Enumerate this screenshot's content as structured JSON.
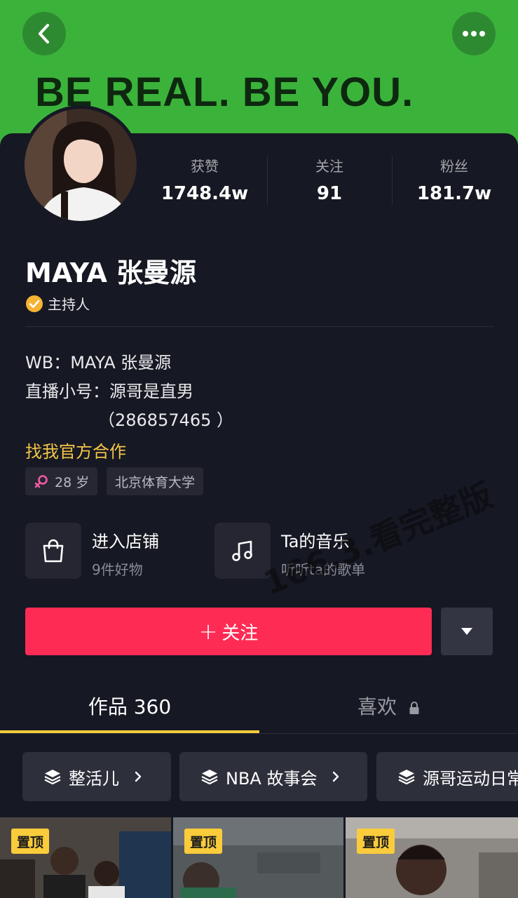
{
  "banner": {
    "slogan": "BE REAL. BE YOU."
  },
  "stats": [
    {
      "label": "获赞",
      "value": "1748.4w"
    },
    {
      "label": "关注",
      "value": "91"
    },
    {
      "label": "粉丝",
      "value": "181.7w"
    }
  ],
  "profile": {
    "name": "MAYA 张曼源",
    "verified_title": "主持人",
    "bio_lines": [
      "WB：MAYA 张曼源",
      "直播小号：源哥是直男",
      "（286857465 ）"
    ],
    "cooperation_link": "找我官方合作",
    "tags": [
      "28 岁",
      "北京体育大学"
    ]
  },
  "entries": [
    {
      "title": "进入店铺",
      "subtitle": "9件好物",
      "icon": "shopping-bag-icon"
    },
    {
      "title": "Ta的音乐",
      "subtitle": "听听ta的歌单",
      "icon": "music-note-icon"
    }
  ],
  "watermark": "166.3.看完整版",
  "actions": {
    "follow_label": "关注",
    "follow_plus": "+"
  },
  "tabs": [
    {
      "label": "作品 360",
      "active": true
    },
    {
      "label": "喜欢",
      "locked": true
    }
  ],
  "collections": [
    "整活儿",
    "NBA 故事会",
    "源哥运动日常"
  ],
  "videos": [
    {
      "pin_label": "置顶"
    },
    {
      "pin_label": "置顶"
    },
    {
      "pin_label": "置顶"
    }
  ],
  "colors": {
    "banner_green": "#3bb33b",
    "background": "#161823",
    "follow_red": "#fe2c55",
    "accent_yellow": "#facc3b",
    "link_gold": "#f3c548",
    "female_pink": "#f15ba4"
  }
}
